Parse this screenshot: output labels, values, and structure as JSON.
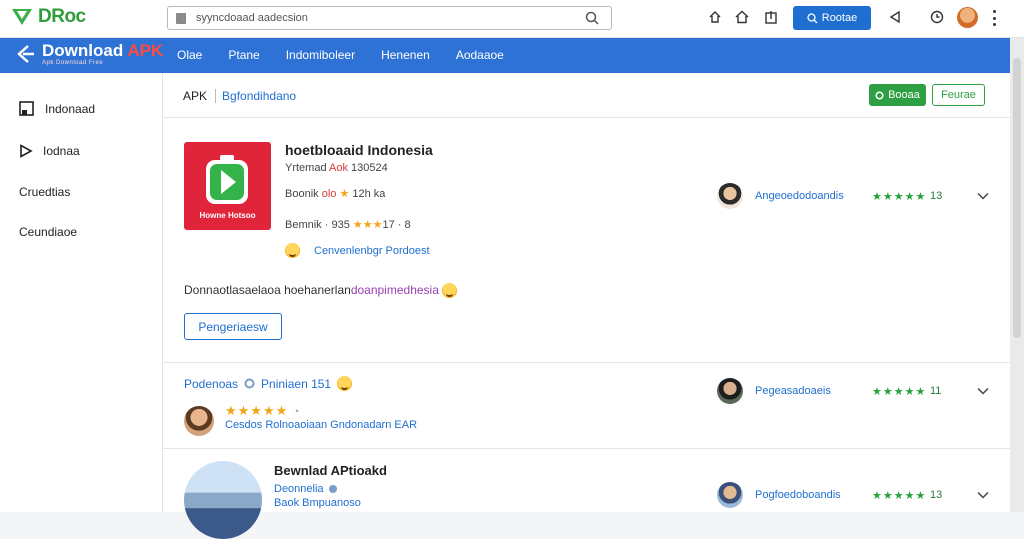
{
  "topbar": {
    "logo_text": "DRoc",
    "search_value": "syyncdoaad aadecsion",
    "primary_button": "Rootae"
  },
  "navbar": {
    "logo_title_main": "Download ",
    "logo_title_accent": "APK",
    "logo_subtitle": "Apk Download Free",
    "items": [
      "Olae",
      "Ptane",
      "Indomiboleer",
      "Henenen",
      "Aodaaoe"
    ]
  },
  "sidebar": {
    "items": [
      {
        "label": "Indonaad",
        "icon": "page-icon"
      },
      {
        "label": "Iodnaa",
        "icon": "play-outline-icon"
      },
      {
        "label": "Cruedtias",
        "icon": ""
      },
      {
        "label": "Ceundiaoe",
        "icon": ""
      }
    ]
  },
  "header": {
    "crumb_main": "APK",
    "crumb_sub": "Bgfondihdano",
    "green_button": "Booaa",
    "outline_button": "Feurae"
  },
  "app": {
    "icon_caption": "Howne Hotsoo",
    "title": "hoetbloaaid Indonesia",
    "meta1_prefix": "Yrtemad ",
    "meta1_accent": "Aok",
    "meta1_suffix": " 130524",
    "meta2_prefix": "Boonik ",
    "meta2_accent": "olo",
    "meta2_star": "★",
    "meta2_suffix": " 12h ka",
    "meta3_prefix": "Bemnik · 935 ",
    "meta3_stars": "★★★",
    "meta3_suffix": "17 · 8",
    "link": "Cenvenlenbgr Pordoest",
    "description_main": "Donnaotlasaelaoa hoehanerlan",
    "description_accent": "doanpimedhesia",
    "button": "Pengeriaesw"
  },
  "reviews": [
    {
      "name": "Angeoedodoandis",
      "stars": "★★★★★",
      "count": "13"
    },
    {
      "name": "Pegeasadoaeis",
      "stars": "★★★★★",
      "count": "11"
    },
    {
      "name": "Pogfoedoboandis",
      "stars": "★★★★★",
      "count": "13"
    }
  ],
  "card2": {
    "title": "Podenoas",
    "title_extra": "Pniniaen 151",
    "stars": "★★★★★",
    "subtitle": "Cesdos Rolnoaoiaan Gndonadarn EAR"
  },
  "card3": {
    "title": "Bewnlad APtioakd",
    "sub1": "Deonnelia",
    "sub2": "Baok Bmpuanoso"
  },
  "colors": {
    "brand_blue": "#2f72d6",
    "accent_blue": "#1f6fd1",
    "green": "#2ea043",
    "red": "#e0253b"
  }
}
